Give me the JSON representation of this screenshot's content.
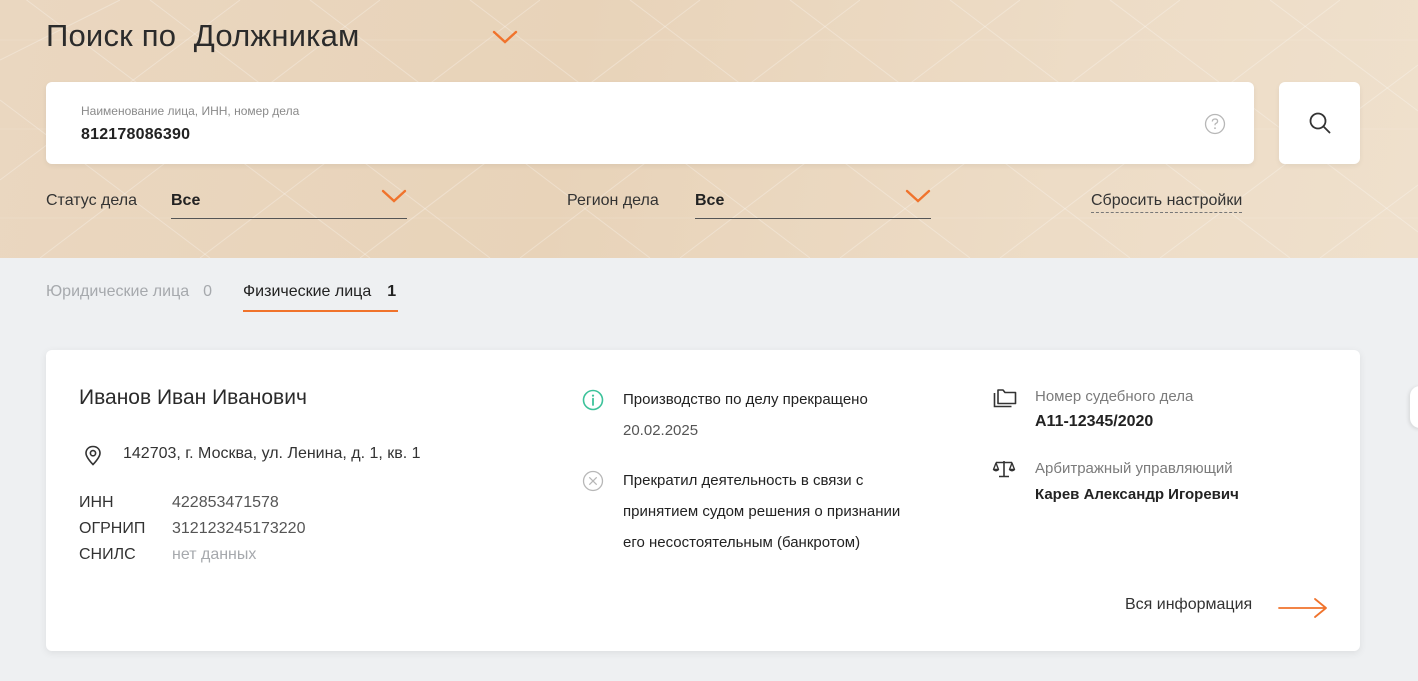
{
  "header": {
    "title_prefix": "Поиск по",
    "title_target": "Должникам"
  },
  "search": {
    "label": "Наименование лица, ИНН, номер дела",
    "value": "812178086390"
  },
  "filters": {
    "status_label": "Статус дела",
    "status_value": "Все",
    "region_label": "Регион дела",
    "region_value": "Все",
    "reset_label": "Сбросить настройки"
  },
  "tabs": [
    {
      "label": "Юридические лица",
      "count": "0",
      "active": false
    },
    {
      "label": "Физические лица",
      "count": "1",
      "active": true
    }
  ],
  "result": {
    "name": "Иванов Иван Иванович",
    "address": "142703, г. Москва, ул. Ленина, д. 1, кв. 1",
    "fields": [
      {
        "key": "ИНН",
        "value": "422853471578"
      },
      {
        "key": "ОГРНИП",
        "value": "312123245173220"
      },
      {
        "key": "СНИЛС",
        "value": "нет данных"
      }
    ],
    "status_main": "Производство по делу прекращено",
    "status_date": "20.02.2025",
    "status_reason": [
      "Прекратил деятельность в связи с",
      "принятием судом решения о признании",
      "его несостоятельным (банкротом)"
    ],
    "case_label": "Номер судебного дела",
    "case_number": "А11-12345/2020",
    "manager_label": "Арбитражный управляющий",
    "manager_name": "Карев Александр Игоревич",
    "more_label": "Вся информация"
  },
  "colors": {
    "accent": "#f0732c",
    "status_ok": "#3cc29a",
    "muted": "#a6a9ad"
  },
  "icons": [
    "chevron-down-icon",
    "help-icon",
    "search-icon",
    "location-pin-icon",
    "info-circle-icon",
    "close-circle-icon",
    "folder-icon",
    "scales-icon",
    "arrow-right-icon"
  ]
}
